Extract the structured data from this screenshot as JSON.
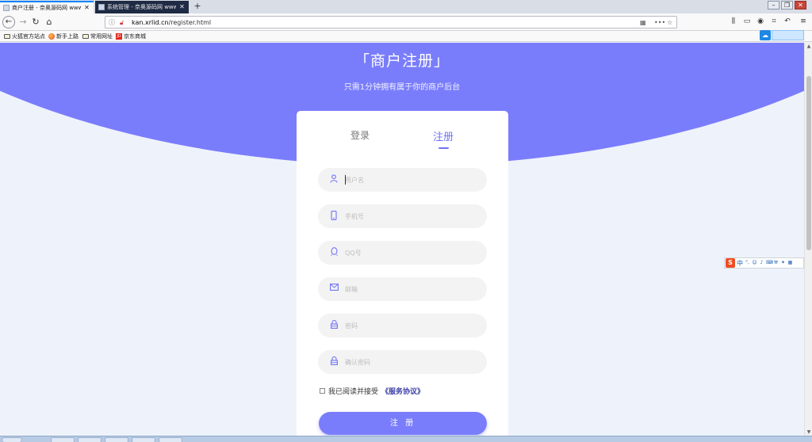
{
  "browser": {
    "tabs": [
      {
        "title": "商户注册 - 奈奥源码网 www.o",
        "active": true
      },
      {
        "title": "系统管理 - 奈奥源码网 www.o",
        "active": false
      }
    ],
    "new_tab": "+",
    "url": {
      "domain": "kan.xrlid.cn",
      "path": "/register.html"
    },
    "bookmarks": [
      {
        "label": "火狐官方站点",
        "icon": "folder-icon"
      },
      {
        "label": "新手上路",
        "icon": "firefox-icon"
      },
      {
        "label": "常用网址",
        "icon": "folder-icon"
      },
      {
        "label": "京东商城",
        "icon": "jd-icon"
      }
    ],
    "jd_icon_text": "JD"
  },
  "page": {
    "title": "「商户注册」",
    "subtitle": "只需1分钟拥有属于你的商户后台",
    "tabs": {
      "login": "登录",
      "register": "注册"
    },
    "fields": [
      {
        "name": "username",
        "placeholder": "用户名",
        "icon": "user-icon"
      },
      {
        "name": "phone",
        "placeholder": "手机号",
        "icon": "phone-icon"
      },
      {
        "name": "qq",
        "placeholder": "QQ号",
        "icon": "qq-icon"
      },
      {
        "name": "email",
        "placeholder": "邮箱",
        "icon": "mail-icon"
      },
      {
        "name": "password",
        "placeholder": "密码",
        "icon": "lock-icon"
      },
      {
        "name": "confirm",
        "placeholder": "确认密码",
        "icon": "lock-icon"
      }
    ],
    "agree_text": "我已阅读并接受",
    "agree_link": "《服务协议》",
    "submit_label": "注 册"
  },
  "ime": {
    "logo": "S",
    "mode": "中"
  },
  "colors": {
    "accent": "#7a7dfb",
    "background": "#eef3fb"
  }
}
